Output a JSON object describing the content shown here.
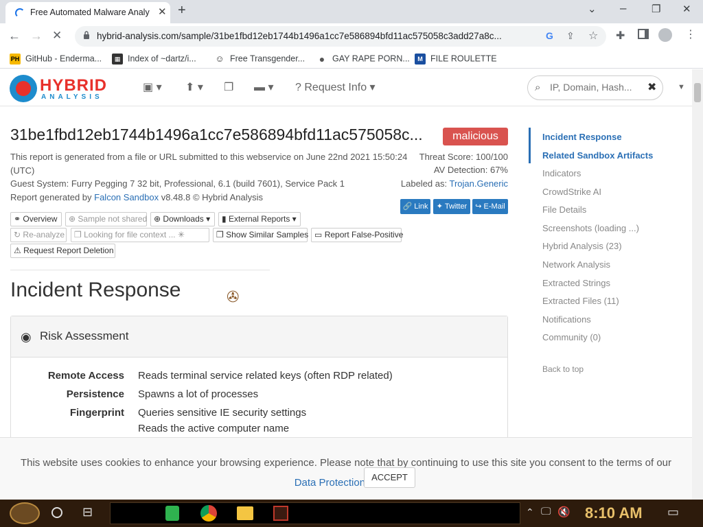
{
  "browser": {
    "tab_title": "Free Automated Malware Analy",
    "url": "hybrid-analysis.com/sample/31be1fbd12eb1744b1496a1cc7e586894bfd11ac575058c3add27a8c...",
    "bookmarks": [
      {
        "label": "GitHub - Enderma...",
        "icon": "PH"
      },
      {
        "label": "Index of ~dartz/i...",
        "icon": "grid"
      },
      {
        "label": "Free Transgender...",
        "icon": "mask"
      },
      {
        "label": "GAY RAPE PORN...",
        "icon": "globe"
      },
      {
        "label": "FILE ROULETTE",
        "icon": "M"
      }
    ]
  },
  "header": {
    "logo_main": "HYBRID",
    "logo_sub": "ANALYSIS",
    "request_info": "Request Info",
    "search_placeholder": "IP, Domain, Hash..."
  },
  "report": {
    "hash": "31be1fbd12eb1744b1496a1cc7e586894bfd11ac575058c...",
    "verdict": "malicious",
    "generated_line1": "This report is generated from a file or URL submitted to this webservice on June 22nd 2021 15:50:24",
    "generated_line2": "(UTC)",
    "guest_system": "Guest System: Furry Pegging 7 32 bit, Professional, 6.1 (build 7601), Service Pack 1",
    "generated_by_prefix": "Report generated by ",
    "generated_by_link": "Falcon Sandbox",
    "generated_by_suffix": " v8.48.8 © Hybrid Analysis",
    "threat_score": "Threat Score: 100/100",
    "av_detection": "AV Detection: 67%",
    "labeled_as_prefix": "Labeled as: ",
    "labeled_as": "Trojan.Generic",
    "share": {
      "link": "Link",
      "twitter": "Twitter",
      "email": "E-Mail"
    },
    "buttons": {
      "overview": "Overview",
      "sample_not_shared": "Sample not shared",
      "downloads": "Downloads",
      "external_reports": "External Reports",
      "reanalyze": "Re-analyze",
      "looking_context": "Looking for file context ...",
      "show_similar": "Show Similar Samples",
      "report_fp": "Report False-Positive",
      "request_deletion": "Request Report Deletion"
    }
  },
  "incident": {
    "title": "Incident Response",
    "panel_title": "Risk Assessment",
    "rows": [
      {
        "key": "Remote Access",
        "values": [
          "Reads terminal service related keys (often RDP related)"
        ]
      },
      {
        "key": "Persistence",
        "values": [
          "Spawns a lot of processes"
        ]
      },
      {
        "key": "Fingerprint",
        "values": [
          "Queries sensitive IE security settings",
          "Reads the active computer name"
        ]
      }
    ]
  },
  "sidenav": {
    "items": [
      {
        "label": "Incident Response",
        "active": true
      },
      {
        "label": "Related Sandbox Artifacts",
        "active": true
      },
      {
        "label": "Indicators",
        "active": false
      },
      {
        "label": "CrowdStrike AI",
        "active": false
      },
      {
        "label": "File Details",
        "active": false
      },
      {
        "label": "Screenshots (loading ...)",
        "active": false
      },
      {
        "label": "Hybrid Analysis (23)",
        "active": false
      },
      {
        "label": "Network Analysis",
        "active": false
      },
      {
        "label": "Extracted Strings",
        "active": false
      },
      {
        "label": "Extracted Files (11)",
        "active": false
      },
      {
        "label": "Notifications",
        "active": false
      },
      {
        "label": "Community (0)",
        "active": false
      }
    ],
    "back_to_top": "Back to top"
  },
  "cookie": {
    "text": "This website uses cookies to enhance your browsing experience. Please note that by continuing to use this site you consent to the terms of our ",
    "link": "Data Protection Policy.",
    "accept": "ACCEPT"
  },
  "taskbar": {
    "time": "8:10 AM"
  },
  "colors": {
    "brand_red": "#e8312b",
    "brand_blue": "#1d8ccd",
    "link": "#2a6fb5",
    "malicious": "#d9534f"
  }
}
